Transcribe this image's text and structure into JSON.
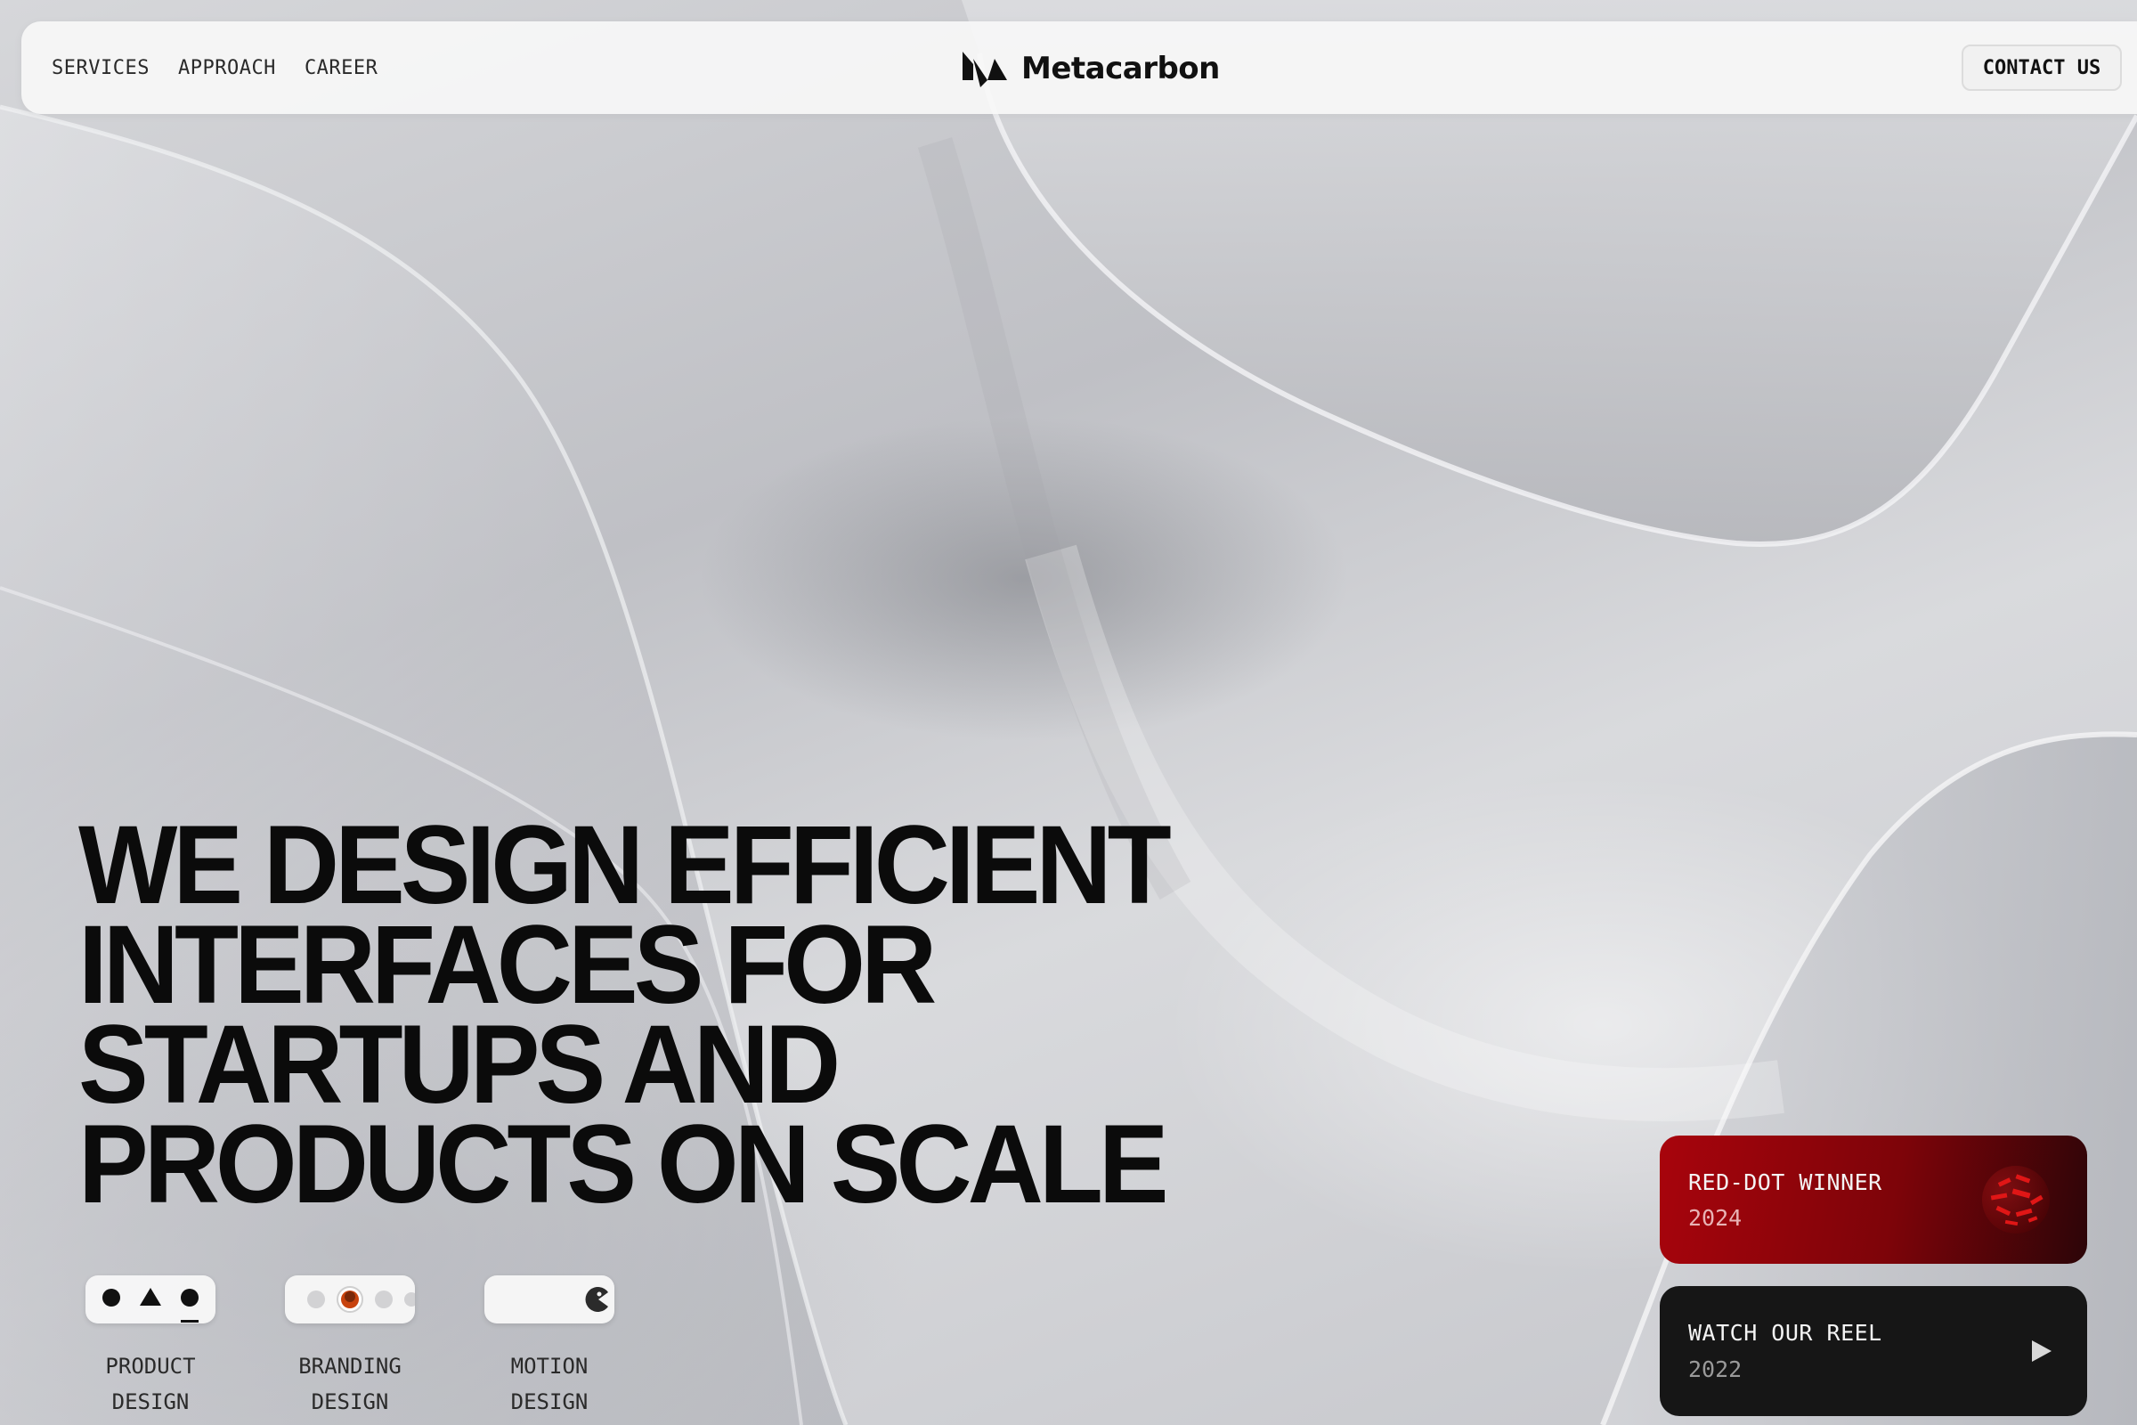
{
  "nav": {
    "links": [
      "SERVICES",
      "APPROACH",
      "CAREER"
    ],
    "logo_text": "Metacarbon",
    "contact_label": "CONTACT US"
  },
  "hero": {
    "lines": [
      "WE DESIGN EFFICIENT",
      "INTERFACES FOR",
      "STARTUPS AND",
      "PRODUCTS ON SCALE"
    ]
  },
  "services": [
    {
      "line1": "PRODUCT",
      "line2": "DESIGN",
      "icon": "shapes-icon"
    },
    {
      "line1": "BRANDING",
      "line2": "DESIGN",
      "icon": "dots-icon"
    },
    {
      "line1": "MOTION",
      "line2": "DESIGN",
      "icon": "pacman-icon"
    }
  ],
  "cards": {
    "award": {
      "title": "RED-DOT WINNER",
      "year": "2024",
      "icon": "reddot-award-icon"
    },
    "reel": {
      "title": "WATCH OUR REEL",
      "year": "2022",
      "icon": "play-icon"
    }
  },
  "colors": {
    "award_red": "#a8040c",
    "dark_card": "#161616",
    "text_dark": "#0b0b0b",
    "accent_orange": "#c8430e"
  }
}
